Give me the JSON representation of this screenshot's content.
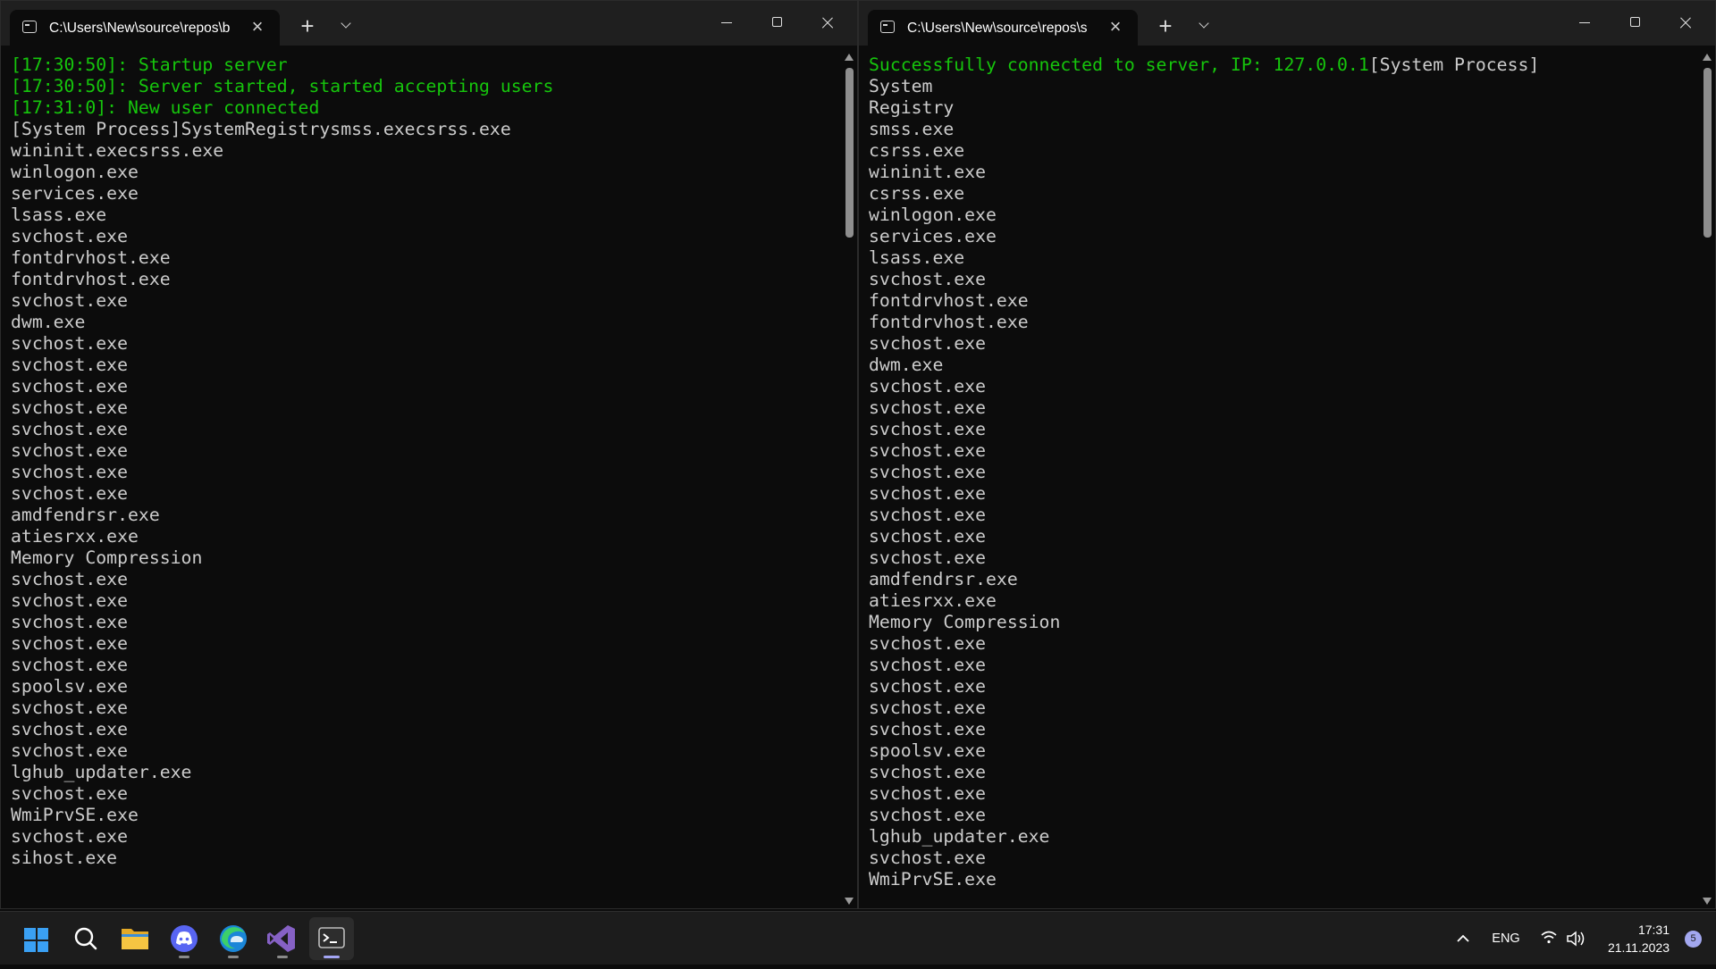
{
  "windows": [
    {
      "tab_title": "C:\\Users\\New\\source\\repos\\b",
      "lines": [
        {
          "text": "[17:30:50]: Startup server",
          "color": "green"
        },
        {
          "text": "[17:30:50]: Server started, started accepting users",
          "color": "green"
        },
        {
          "text": "[17:31:0]: New user connected",
          "color": "green"
        },
        {
          "text": "[System Process]SystemRegistrysmss.execsrss.exe"
        },
        {
          "text": "wininit.execsrss.exe"
        },
        {
          "text": "winlogon.exe"
        },
        {
          "text": "services.exe"
        },
        {
          "text": "lsass.exe"
        },
        {
          "text": "svchost.exe"
        },
        {
          "text": "fontdrvhost.exe"
        },
        {
          "text": "fontdrvhost.exe"
        },
        {
          "text": "svchost.exe"
        },
        {
          "text": "dwm.exe"
        },
        {
          "text": "svchost.exe"
        },
        {
          "text": "svchost.exe"
        },
        {
          "text": "svchost.exe"
        },
        {
          "text": "svchost.exe"
        },
        {
          "text": "svchost.exe"
        },
        {
          "text": "svchost.exe"
        },
        {
          "text": "svchost.exe"
        },
        {
          "text": "svchost.exe"
        },
        {
          "text": "amdfendrsr.exe"
        },
        {
          "text": "atiesrxx.exe"
        },
        {
          "text": "Memory Compression"
        },
        {
          "text": "svchost.exe"
        },
        {
          "text": "svchost.exe"
        },
        {
          "text": "svchost.exe"
        },
        {
          "text": "svchost.exe"
        },
        {
          "text": "svchost.exe"
        },
        {
          "text": "spoolsv.exe"
        },
        {
          "text": "svchost.exe"
        },
        {
          "text": "svchost.exe"
        },
        {
          "text": "svchost.exe"
        },
        {
          "text": "lghub_updater.exe"
        },
        {
          "text": "svchost.exe"
        },
        {
          "text": "WmiPrvSE.exe"
        },
        {
          "text": "svchost.exe"
        },
        {
          "text": "sihost.exe"
        }
      ]
    },
    {
      "tab_title": "C:\\Users\\New\\source\\repos\\s",
      "lines": [
        {
          "segments": [
            {
              "text": "Successfully connected to server, IP: 127.0.0.1",
              "color": "green"
            },
            {
              "text": "[System Process]"
            }
          ]
        },
        {
          "text": "System"
        },
        {
          "text": "Registry"
        },
        {
          "text": "smss.exe"
        },
        {
          "text": "csrss.exe"
        },
        {
          "text": "wininit.exe"
        },
        {
          "text": "csrss.exe"
        },
        {
          "text": "winlogon.exe"
        },
        {
          "text": "services.exe"
        },
        {
          "text": "lsass.exe"
        },
        {
          "text": "svchost.exe"
        },
        {
          "text": "fontdrvhost.exe"
        },
        {
          "text": "fontdrvhost.exe"
        },
        {
          "text": "svchost.exe"
        },
        {
          "text": "dwm.exe"
        },
        {
          "text": "svchost.exe"
        },
        {
          "text": "svchost.exe"
        },
        {
          "text": "svchost.exe"
        },
        {
          "text": "svchost.exe"
        },
        {
          "text": "svchost.exe"
        },
        {
          "text": "svchost.exe"
        },
        {
          "text": "svchost.exe"
        },
        {
          "text": "svchost.exe"
        },
        {
          "text": "svchost.exe"
        },
        {
          "text": "amdfendrsr.exe"
        },
        {
          "text": "atiesrxx.exe"
        },
        {
          "text": "Memory Compression"
        },
        {
          "text": "svchost.exe"
        },
        {
          "text": "svchost.exe"
        },
        {
          "text": "svchost.exe"
        },
        {
          "text": "svchost.exe"
        },
        {
          "text": "svchost.exe"
        },
        {
          "text": "spoolsv.exe"
        },
        {
          "text": "svchost.exe"
        },
        {
          "text": "svchost.exe"
        },
        {
          "text": "svchost.exe"
        },
        {
          "text": "lghub_updater.exe"
        },
        {
          "text": "svchost.exe"
        },
        {
          "text": "WmiPrvSE.exe"
        }
      ]
    }
  ],
  "icons": {
    "tab": "terminal-tab-icon",
    "close": "close-icon",
    "new_tab": "plus-icon",
    "dropdown": "chevron-down-icon",
    "minimize": "minimize-icon",
    "maximize": "maximize-icon",
    "window_close": "close-icon"
  },
  "glyphs": {
    "close": "×",
    "plus": "+"
  },
  "colors": {
    "console_bg": "#0c0c0c",
    "console_text": "#cccccc",
    "green": "#16c60c",
    "taskbar_bg": "#1c1c1c",
    "accent": "#a4a6f5"
  },
  "taskbar": {
    "apps": [
      {
        "name": "start-button",
        "icon": "windows-logo-icon"
      },
      {
        "name": "search-button",
        "icon": "search-icon"
      },
      {
        "name": "file-explorer",
        "icon": "folder-icon"
      },
      {
        "name": "discord",
        "icon": "discord-icon"
      },
      {
        "name": "edge",
        "icon": "edge-icon"
      },
      {
        "name": "visual-studio",
        "icon": "visual-studio-icon"
      },
      {
        "name": "terminal",
        "icon": "terminal-icon"
      }
    ],
    "tray": {
      "chevron_icon": "chevron-up-icon",
      "language": "ENG",
      "wifi_icon": "wifi-icon",
      "volume_icon": "volume-icon",
      "time": "17:31",
      "date": "21.11.2023",
      "notification_count": "5"
    }
  }
}
